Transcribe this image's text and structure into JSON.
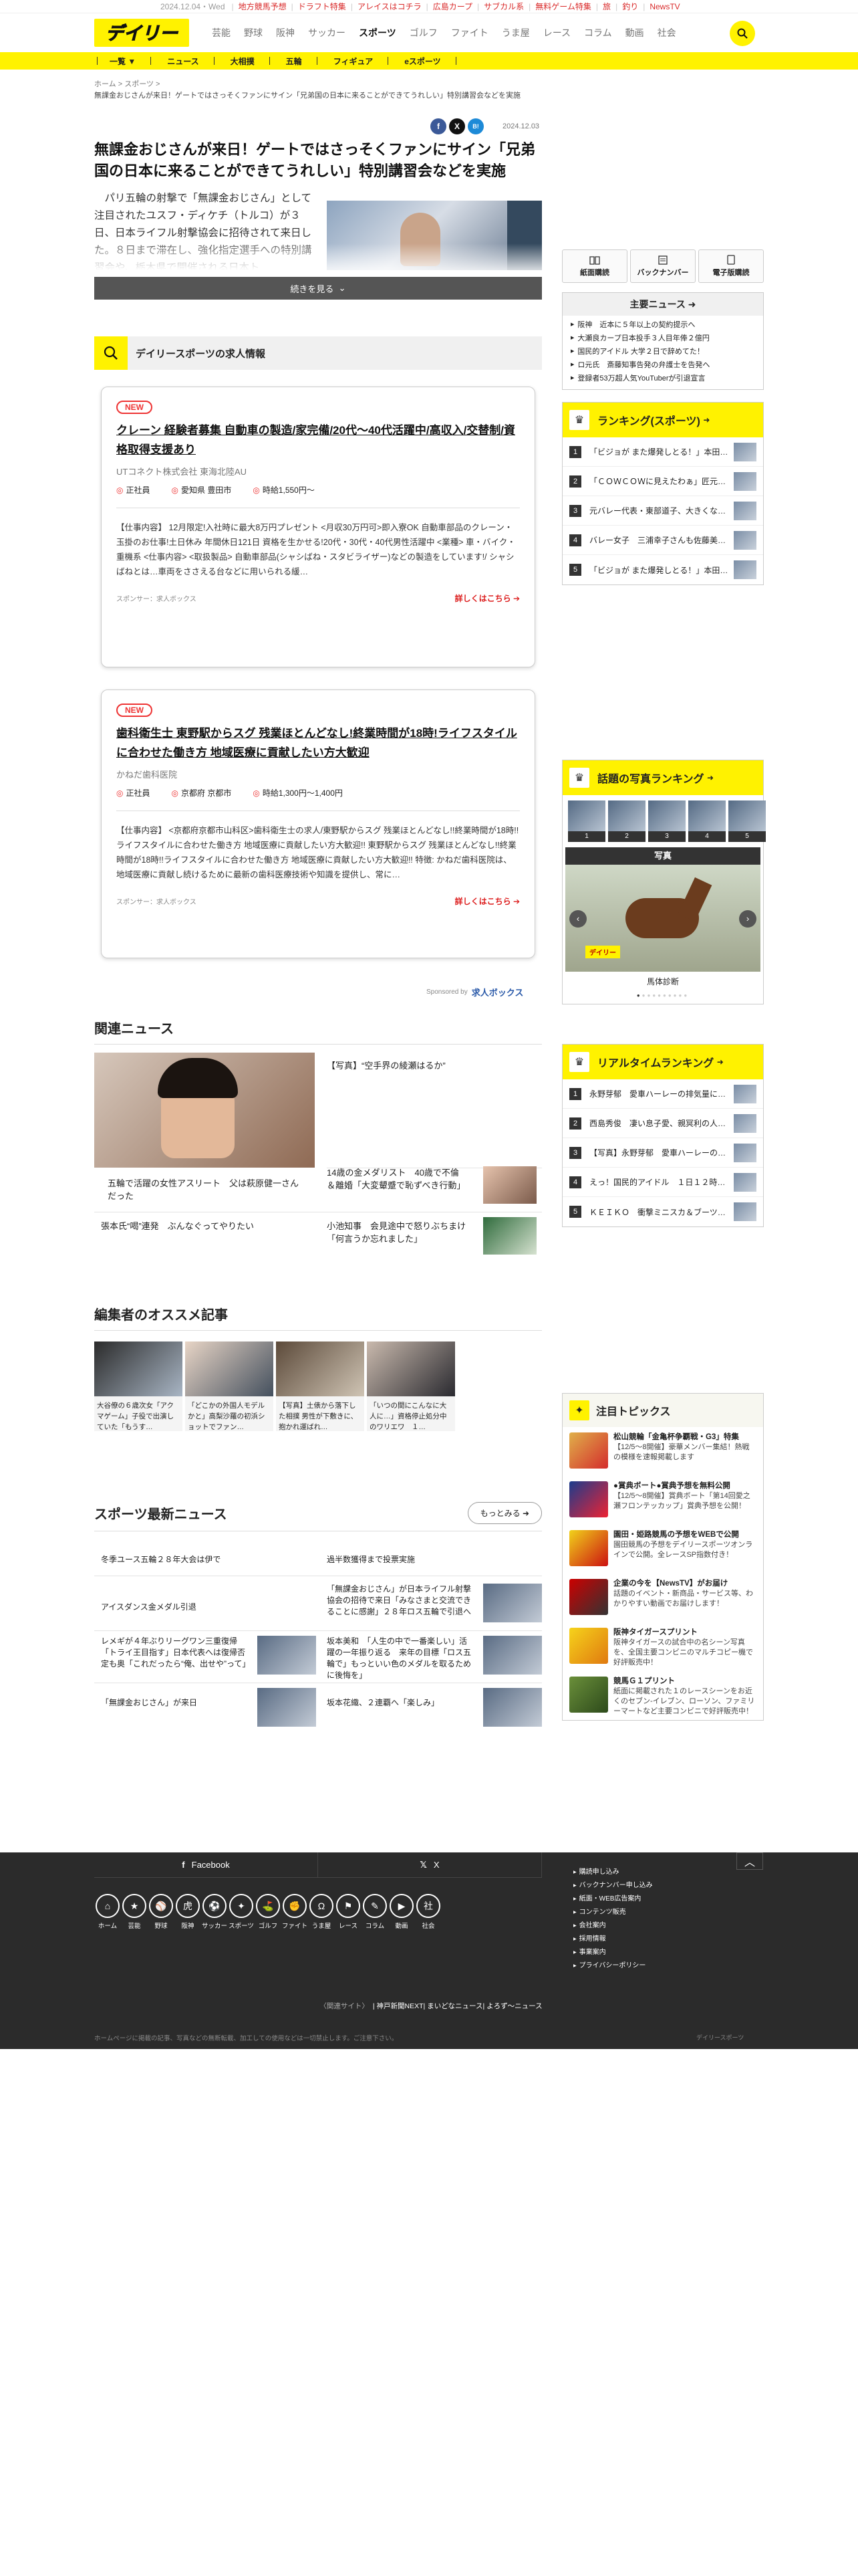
{
  "topbar": {
    "date": "2024.12.04・Wed",
    "links": [
      "地方競馬予想",
      "ドラフト特集",
      "アレイスはコチラ",
      "広島カープ",
      "サブカル系",
      "無料ゲーム特集",
      "旅",
      "釣り",
      "NewsTV"
    ]
  },
  "header": {
    "logo_text": "デイリー",
    "nav": [
      "芸能",
      "野球",
      "阪神",
      "サッカー",
      "スポーツ",
      "ゴルフ",
      "ファイト",
      "うま屋",
      "レース",
      "コラム",
      "動画",
      "社会"
    ],
    "nav_active": "スポーツ"
  },
  "subnav": {
    "list_label": "一覧",
    "items": [
      "ニュース",
      "大相撲",
      "五輪",
      "フィギュア",
      "eスポーツ"
    ]
  },
  "breadcrumb": {
    "home": "ホーム",
    "section": "スポーツ",
    "current": "無課金おじさんが来日！ゲートではさっそくファンにサイン「兄弟国の日本に来ることができてうれしい」特別講習会などを実施"
  },
  "article": {
    "date": "2024.12.03",
    "share": [
      "f",
      "X",
      "B!"
    ],
    "headline": "無課金おじさんが来日！ゲートではさっそくファンにサイン「兄弟国の日本に来ることができてうれしい」特別講習会などを実施",
    "lead": "パリ五輪の射撃で「無課金おじさん」として注目されたユスフ・ディケチ（トルコ）が３日、日本ライフル射撃協会に招待されて来日した。８日まで滞在し、強化指定選手への特別講習会や、栃木県で開催される日本ト",
    "read_more": "続きを見る"
  },
  "services": [
    "紙面購読",
    "バックナンバー",
    "電子版購読"
  ],
  "main_news": {
    "title": "主要ニュース",
    "items": [
      "阪神　近本に５年以上の契約提示へ",
      "大瀬良カープ日本投手３人目年俸２億円",
      "国民的アイドル 大学２日で辞めてた！",
      "ロ元氏　斎藤知事告発の弁護士を告発へ",
      "登録者53万超人気YouTuberが引退宣言"
    ]
  },
  "ranking_sports": {
    "title": "ランキング(スポーツ)",
    "items": [
      "「ビジョが また爆発しとる！」本田真…",
      "「ＣＯＷＣＯＷに見えたわぁ」匠元巻…",
      "元バレー代表・東部道子、大きくな…",
      "バレー女子　三浦幸子さんも佐藤美和…",
      "「ビジョが また爆発しとる！」本田真…"
    ]
  },
  "jobs": {
    "section_title": "デイリースポーツの求人情報",
    "badge": "NEW",
    "items": [
      {
        "title": "クレーン 経験者募集 自動車の製造/家完備/20代〜40代活躍中/高収入/交替制/資格取得支援あり",
        "company": "UTコネクト株式会社 東海北陸AU",
        "type": "正社員",
        "location": "愛知県 豊田市",
        "wage": "時給1,550円〜",
        "body": "【仕事内容】 12月限定!入社時に最大8万円プレゼント <月収30万円可>即入寮OK 自動車部品のクレーン・玉掛のお仕事!土日休み 年間休日121日 資格を生かせる!20代・30代・40代男性活躍中 <業種> 車・バイク・重機系 <仕事内容> <取扱製品> 自動車部品(シャシばね・スタビライザー)などの製造をしています!/ シャシばねとは…車両をささえる台などに用いられる緩…",
        "sponsor": "スポンサー：求人ボックス",
        "cta": "詳しくはこちら"
      },
      {
        "title": "歯科衛生士 東野駅からスグ 残業ほとんどなし!終業時間が18時!ライフスタイルに合わせた働き方 地域医療に貢献したい方大歓迎",
        "company": "かねだ歯科医院",
        "type": "正社員",
        "location": "京都府 京都市",
        "wage": "時給1,300円〜1,400円",
        "body": "【仕事内容】 <京都府京都市山科区>歯科衛生士の求人/東野駅からスグ 残業ほとんどなし!!終業時間が18時!!ライフスタイルに合わせた働き方 地域医療に貢献したい方大歓迎!! 東野駅からスグ 残業ほとんどなし!!終業時間が18時!!ライフスタイルに合わせた働き方 地域医療に貢献したい方大歓迎!! 特徴: かねだ歯科医院は、地域医療に貢献し続けるために最新の歯科医療技術や知識を提供し、常に…",
        "sponsor": "スポンサー：求人ボックス",
        "cta": "詳しくはこちら"
      }
    ],
    "sponsored_by": "Sponsored by",
    "sponsor_brand": "求人ボックス"
  },
  "photo_ranking": {
    "title": "話題の写真ランキング",
    "nums": [
      "1",
      "2",
      "3",
      "4",
      "5"
    ],
    "label": "写真",
    "caption": "馬体診断",
    "tag": "デイリー"
  },
  "realtime": {
    "title": "リアルタイムランキング",
    "items": [
      "永野芽郁　愛車ハーレーの排気量に爆…",
      "西島秀俊　凄い息子愛、親冥利の人生…",
      "【写真】永野芽郁　愛車ハーレーの排…",
      "えっ！国民的アイドル　１日１２時間…",
      "ＫＥＩＫＯ　衝撃ミニスカ＆ブーツに…"
    ]
  },
  "related": {
    "title": "関連ニュース",
    "items": [
      "【写真】“空手界の綾瀬はるか”",
      "五輪で活躍の女性アスリート　父は萩原健一さんだった",
      "14歳の金メダリスト　40歳で不倫＆離婚「大変顰蹙で恥ずべき行動」",
      "張本氏“喝”連発　ぶんなぐってやりたい",
      "小池知事　会見途中で怒りぶちまけ「何言うか忘れました」"
    ]
  },
  "editor": {
    "title": "編集者のオススメ記事",
    "items": [
      "大谷僚の６歳次女「アクマゲーム」子役で出演していた「もうす…",
      "「どこかの外国人モデルかと」高梨沙羅の初浜ショットでファン…",
      "【写真】土俵から落下した相撲 男性が下敷きに、抱かれ運ばれ…",
      "「いつの間にこんなに大人に…」資格停止処分中のワリエワ　１…"
    ]
  },
  "latest": {
    "title": "スポーツ最新ニュース",
    "more": "もっとみる",
    "left": [
      "冬季ユース五輪２８年大会は伊で",
      "アイスダンス金メダル引退",
      "レメギが４年ぶりリーグワン三重復帰「トライ王目指す」日本代表へは復帰否定も奥「これだったら“俺、出せや”って」",
      "「無課金おじさん」が来日"
    ],
    "right": [
      "過半数獲得まで投票実施",
      "「無課金おじさん」が日本ライフル射撃協会の招待で来日「みなさまと交流できることに感謝」２８年ロス五輪で引退へ",
      "坂本美和　「人生の中で一番楽しい」活躍の一年振り返る　来年の目標「ロス五輪で」もっといい色のメダルを取るために後悔を」",
      "坂本花織、２連覇へ「楽しみ」"
    ]
  },
  "topics": {
    "title": "注目トピックス",
    "items": [
      {
        "head": "松山競輪「金亀杯争覇戦・G3」特集",
        "text": "【12/5〜8開催】豪華メンバー集結！熱戦の模様を速報掲載します"
      },
      {
        "head": "●賞典ボート●賞典予想を無料公開",
        "text": "【12/5〜8開催】賞典ボート「第14回愛之瀬フロンテッカップ」賞典予想を公開！"
      },
      {
        "head": "園田・姫路競馬の予想をWEBで公開",
        "text": "園田競馬の予想をデイリースポーツオンラインで公開。全レースSP指数付き！"
      },
      {
        "head": "企業の今を【NewsTV】がお届け",
        "text": "話題のイベント・新商品・サービス等、わかりやすい動画でお届けします！"
      },
      {
        "head": "阪神タイガースプリント",
        "text": "阪神タイガースの試合中の名シーン写真を、全国主要コンビニのマルチコピー機で好評販売中！"
      },
      {
        "head": "競馬Ｇ１プリント",
        "text": "紙面に掲載された１のレースシーンをお近くのセブン-イレブン、ローソン、ファミリーマートなど主要コンビニで好評販売中！"
      }
    ]
  },
  "footer": {
    "share_facebook": "Facebook",
    "share_x": "X",
    "cats": [
      "ホーム",
      "芸能",
      "野球",
      "阪神",
      "サッカー",
      "スポーツ",
      "ゴルフ",
      "ファイト",
      "うま屋",
      "レース",
      "コラム",
      "動画",
      "社会"
    ],
    "links": [
      "購読申し込み",
      "バックナンバー申し込み",
      "紙面・WEB広告案内",
      "コンテンツ販売",
      "会社案内",
      "採用情報",
      "事業案内",
      "プライバシーポリシー"
    ],
    "sites_label": "〈関連サイト〉",
    "sites": [
      "神戸新聞NEXT",
      "まいどなニュース",
      "よろず〜ニュース"
    ],
    "copyright": "ホームページに掲載の記事、写真などの無断転載、加工しての使用などは一切禁止します。ご注意下さい。",
    "copy2": "デイリースポーツ"
  },
  "colors": {
    "brand_yellow": "#fff200",
    "accent_red": "#d92a2a",
    "footer_bg": "#2b2b2b"
  }
}
